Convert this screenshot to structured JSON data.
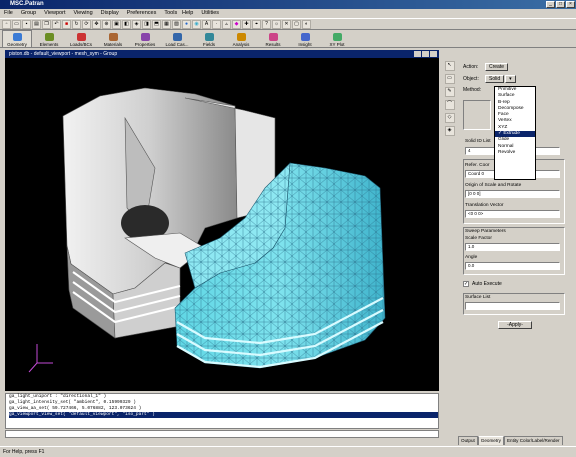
{
  "window": {
    "title": "MSC.Patran"
  },
  "menubar": {
    "left": [
      "File",
      "Group",
      "Viewport",
      "Viewing",
      "Display",
      "Preferences",
      "Tools"
    ],
    "right": [
      "Help",
      "Utilities"
    ]
  },
  "appbar": {
    "items": [
      {
        "label": "Geometry",
        "color": "#3a7bd5",
        "active": true
      },
      {
        "label": "Elements",
        "color": "#6b8e23"
      },
      {
        "label": "Loads/BCs",
        "color": "#cc3333"
      },
      {
        "label": "Materials",
        "color": "#aa6633"
      },
      {
        "label": "Properties",
        "color": "#8844aa"
      },
      {
        "label": "Load Cas...",
        "color": "#3366aa"
      },
      {
        "label": "Fields",
        "color": "#338899"
      },
      {
        "label": "Analysis",
        "color": "#cc8800"
      },
      {
        "label": "Results",
        "color": "#cc4488"
      },
      {
        "label": "Insight",
        "color": "#4466cc"
      },
      {
        "label": "XY Plot",
        "color": "#44aa66"
      }
    ]
  },
  "viewport": {
    "title": "piston.db - default_viewport - mesh_sym - Group"
  },
  "command_history": [
    "ga_light_uniport : \"directional_1\" )",
    "ga_light_intensity_set( \"ambient\", 0.15999329 )",
    "ga_view_aa_set( 59.727466, 5.076882, 123.073624 )",
    "ga_viewport_view_set( \"default_viewport\", \"iso_part\" )"
  ],
  "statusbar": {
    "text": "For Help, press F1"
  },
  "panel": {
    "action_label": "Action:",
    "action_value": "Create",
    "object_label": "Object:",
    "object_value": "Solid",
    "method_label": "Method:",
    "solid_id_label": "Solid ID List",
    "solid_id_value": "4",
    "refer_label": "Refer. Coor",
    "refer_value": "Coord 0",
    "origin_label": "Origin of Scale and Rotate",
    "origin_value": "[0 0 0]",
    "translation_label": "Translation Vector",
    "translation_value": "<0 0 0>",
    "sweep_label": "Sweep Parameters",
    "scale_label": "Scale Factor",
    "scale_value": "1.0",
    "angle_label": "Angle",
    "angle_value": "0.0",
    "auto_execute_label": "Auto Execute",
    "surface_list_label": "Surface List",
    "apply_label": "-Apply-"
  },
  "method_options": [
    "Primitive",
    "Surface",
    "B-rep",
    "Decompose",
    "Face",
    "Vertex",
    "XYZ",
    "Extrude",
    "Glide",
    "Normal",
    "Revolve"
  ],
  "method_selected": "Extrude",
  "tabs": [
    "Output",
    "Geometry",
    "Entity Color/Label/Render"
  ]
}
